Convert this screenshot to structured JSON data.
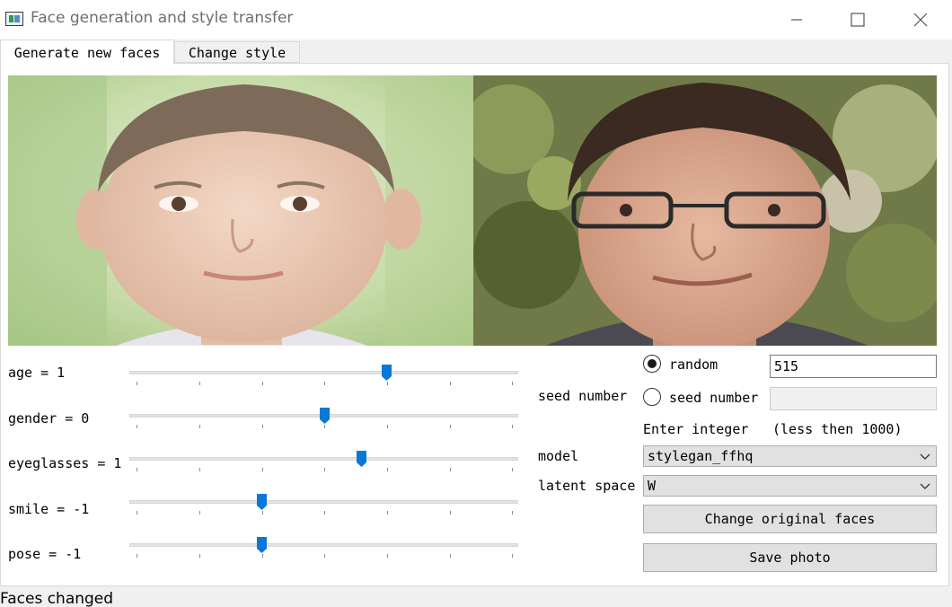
{
  "window": {
    "title": "Face generation and style transfer",
    "controls": [
      "minimize-icon",
      "maximize-icon",
      "close-icon"
    ]
  },
  "tabs": [
    {
      "label": "Generate new faces",
      "active": true
    },
    {
      "label": "Change style",
      "active": false
    }
  ],
  "images": [
    {
      "subject": "young boy face"
    },
    {
      "subject": "man with eyeglasses face"
    }
  ],
  "sliders": [
    {
      "label": "age = 1",
      "value": 1,
      "position": 0.66
    },
    {
      "label": "gender = 0",
      "value": 0,
      "position": 0.5
    },
    {
      "label": "eyeglasses = 1",
      "value": 1,
      "position": 0.595
    },
    {
      "label": "smile = -1",
      "value": -1,
      "position": 0.34
    },
    {
      "label": "pose = -1",
      "value": -1,
      "position": 0.34
    }
  ],
  "seed": {
    "label": "seed number",
    "random_label": "random",
    "random_selected": true,
    "random_value": "515",
    "manual_label": "seed number",
    "manual_value": "",
    "hint_prefix": "Enter integer",
    "hint": "(less then 1000)"
  },
  "model": {
    "label": "model",
    "selected": "stylegan_ffhq"
  },
  "latent": {
    "label": "latent space",
    "selected": "W"
  },
  "buttons": {
    "change_faces": "Change original faces",
    "save_photo": "Save photo"
  },
  "status": "Faces changed",
  "colors": {
    "accent": "#0a78d6",
    "button_bg": "#e1e1e1",
    "window_bg": "#f0f0f0"
  }
}
